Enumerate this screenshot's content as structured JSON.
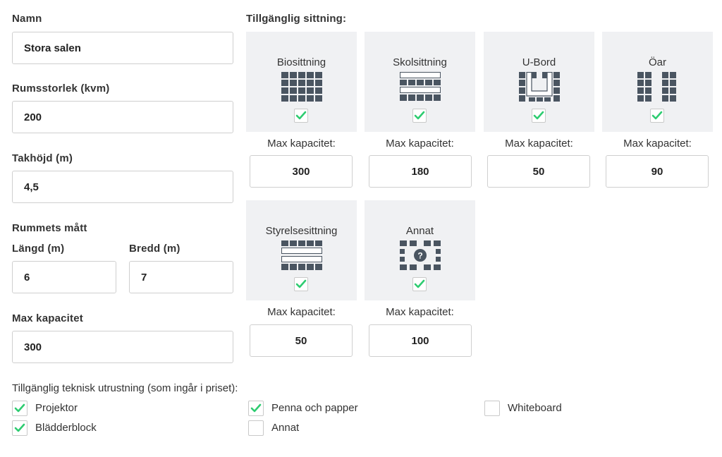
{
  "form": {
    "name_label": "Namn",
    "name_value": "Stora salen",
    "size_label": "Rumsstorlek (kvm)",
    "size_value": "200",
    "height_label": "Takhöjd (m)",
    "height_value": "4,5",
    "dims_label": "Rummets mått",
    "length_label": "Längd (m)",
    "length_value": "6",
    "width_label": "Bredd (m)",
    "width_value": "7",
    "capacity_label": "Max kapacitet",
    "capacity_value": "300"
  },
  "seating": {
    "title": "Tillgänglig sittning:",
    "cap_label": "Max kapacitet:",
    "options": [
      {
        "name": "Biosittning",
        "icon": "theater-seating-icon",
        "checked": true,
        "capacity": "300"
      },
      {
        "name": "Skolsittning",
        "icon": "classroom-seating-icon",
        "checked": true,
        "capacity": "180"
      },
      {
        "name": "U-Bord",
        "icon": "u-table-icon",
        "checked": true,
        "capacity": "50"
      },
      {
        "name": "Öar",
        "icon": "islands-icon",
        "checked": true,
        "capacity": "90"
      },
      {
        "name": "Styrelsesittning",
        "icon": "boardroom-icon",
        "checked": true,
        "capacity": "50"
      },
      {
        "name": "Annat",
        "icon": "other-seating-icon",
        "checked": true,
        "capacity": "100"
      }
    ]
  },
  "equipment": {
    "title": "Tillgänglig teknisk utrustning (som ingår i priset):",
    "items": [
      {
        "label": "Projektor",
        "checked": true
      },
      {
        "label": "Penna och papper",
        "checked": true
      },
      {
        "label": "Whiteboard",
        "checked": false
      },
      {
        "label": "Blädderblock",
        "checked": true
      },
      {
        "label": "Annat",
        "checked": false
      }
    ]
  },
  "colors": {
    "check": "#2ecc71",
    "icon": "#4a5561",
    "card_bg": "#f0f1f3"
  }
}
